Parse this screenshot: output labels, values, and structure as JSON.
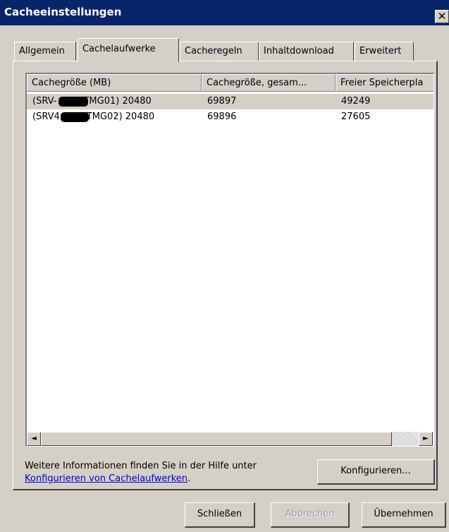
{
  "window": {
    "title": "Cacheeinstellungen",
    "close_glyph": "✕"
  },
  "tabs": [
    {
      "label": "Allgemein"
    },
    {
      "label": "Cachelaufwerke"
    },
    {
      "label": "Cacheregeln"
    },
    {
      "label": "Inhaltdownload"
    },
    {
      "label": "Erweitert"
    }
  ],
  "active_tab": "Cachelaufwerke",
  "list": {
    "columns": [
      {
        "label": "Cachegröße (MB)"
      },
      {
        "label": "Cachegröße, gesam..."
      },
      {
        "label": "Freier Speicherpla"
      }
    ],
    "rows": [
      {
        "name_prefix": "(SRV-",
        "name_suffix": "TMG01) 20480",
        "total": "69897",
        "free": "49249",
        "selected": true
      },
      {
        "name_prefix": "(SRV4",
        "name_suffix": "TMG02) 20480",
        "total": "69896",
        "free": "27605",
        "selected": false
      }
    ],
    "scroll_left_glyph": "◄",
    "scroll_right_glyph": "►"
  },
  "info": {
    "text": "Weitere Informationen finden Sie in der Hilfe unter",
    "link_text": "Konfigurieren von Cachelaufwerken",
    "suffix": "."
  },
  "buttons": {
    "configure": "Konfigurieren...",
    "close": "Schließen",
    "cancel": "Abbrechen",
    "apply": "Übernehmen"
  }
}
